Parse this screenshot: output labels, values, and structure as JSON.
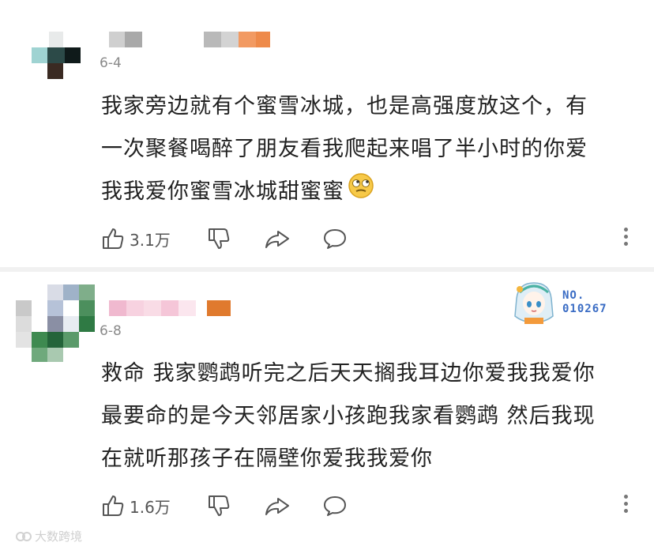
{
  "comments": [
    {
      "date": "6-4",
      "lines": [
        "我家旁边就有个蜜雪冰城，也是高强度放这个，有",
        "一次聚餐喝醉了朋友看我爬起来唱了半小时的你爱",
        "我我爱你蜜雪冰城甜蜜蜜"
      ],
      "emoji": "rolling-eyes-emoji",
      "likes": "3.1万"
    },
    {
      "date": "6-8",
      "lines": [
        "救命 我家鹦鹉听完之后天天搁我耳边你爱我我爱你",
        "最要命的是今天邻居家小孩跑我家看鹦鹉 然后我现",
        "在就听那孩子在隔壁你爱我我爱你"
      ],
      "likes": "1.6万",
      "badge": {
        "label": "NO.",
        "number": "010267"
      }
    }
  ],
  "watermark": "大数跨境",
  "icons": {
    "like": "thumbs-up-icon",
    "dislike": "thumbs-down-icon",
    "share": "share-icon",
    "comment": "comment-bubble-icon",
    "more": "more-vertical-icon"
  }
}
